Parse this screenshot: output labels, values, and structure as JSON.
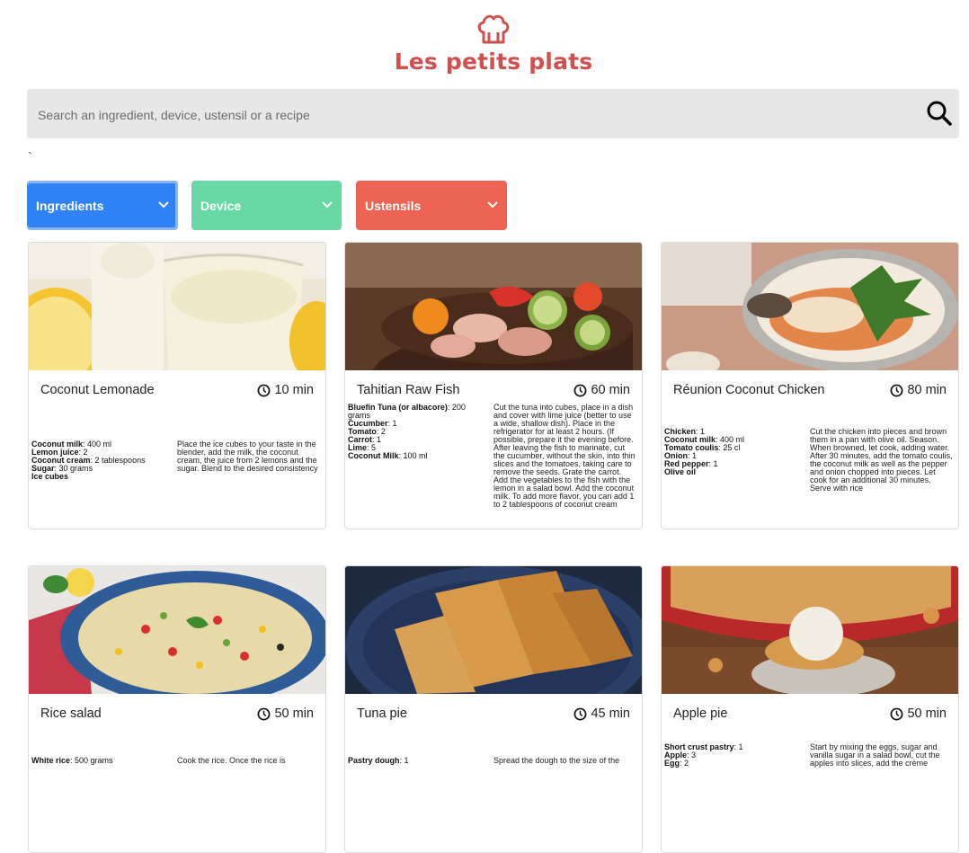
{
  "brand": {
    "title": "Les petits plats",
    "logo_icon": "chef-hat-icon",
    "color": "#D04F4F"
  },
  "search": {
    "placeholder": "Search an ingredient, device, ustensil or a recipe",
    "value": "",
    "icon": "search-icon"
  },
  "stray_text": "`",
  "filters": [
    {
      "label": "Ingredients",
      "color": "#3282F7",
      "icon": "chevron-down-icon"
    },
    {
      "label": "Device",
      "color": "#68D9A4",
      "icon": "chevron-down-icon"
    },
    {
      "label": "Ustensils",
      "color": "#ED6454",
      "icon": "chevron-down-icon"
    }
  ],
  "recipes": [
    {
      "title": "Coconut Lemonade",
      "time": "10 min",
      "clock_icon": "clock-icon",
      "ingredients": [
        {
          "name": "Coconut milk",
          "qty": "400 ml"
        },
        {
          "name": "Lemon juice",
          "qty": "2"
        },
        {
          "name": "Coconut cream",
          "qty": "2 tablespoons"
        },
        {
          "name": "Sugar",
          "qty": "30 grams"
        },
        {
          "name": "Ice cubes",
          "qty": ""
        }
      ],
      "description": "Place the ice cubes to your taste in the blender, add the milk, the coconut cream, the juice from 2 lemons and the sugar. Blend to the desired consistency"
    },
    {
      "title": "Tahitian Raw Fish",
      "time": "60 min",
      "clock_icon": "clock-icon",
      "ingredients": [
        {
          "name": "Bluefin Tuna (or albacore)",
          "qty": "200 grams"
        },
        {
          "name": "Cucumber",
          "qty": "1"
        },
        {
          "name": "Tomato",
          "qty": "2"
        },
        {
          "name": "Carrot",
          "qty": "1"
        },
        {
          "name": "Lime",
          "qty": "5"
        },
        {
          "name": "Coconut Milk",
          "qty": "100 ml"
        }
      ],
      "description": "Cut the tuna into cubes, place in a dish and cover with lime juice (better to use a wide, shallow dish). Place in the refrigerator for at least 2 hours. (If possible, prepare it the evening before. After leaving the fish to marinate, cut the cucumber, without the skin, into thin slices and the tomatoes, taking care to remove the seeds. Grate the carrot. Add the vegetables to the fish with the lemon in a salad bowl. Add the coconut milk. To add more flavor, you can add 1 to 2 tablespoons of coconut cream"
    },
    {
      "title": "Réunion Coconut Chicken",
      "time": "80 min",
      "clock_icon": "clock-icon",
      "ingredients": [
        {
          "name": "Chicken",
          "qty": "1"
        },
        {
          "name": "Coconut milk",
          "qty": "400 ml"
        },
        {
          "name": "Tomato coulis",
          "qty": "25 cl"
        },
        {
          "name": "Onion",
          "qty": "1"
        },
        {
          "name": "Red pepper",
          "qty": "1"
        },
        {
          "name": "Olive oil",
          "qty": ""
        }
      ],
      "description": "Cut the chicken into pieces and brown them in a pan with olive oil. Season. When browned, let cook, adding water. After 30 minutes, add the tomato coulis, the coconut milk as well as the pepper and onion chopped into pieces. Let cook for an additional 30 minutes. Serve with rice"
    },
    {
      "title": "Rice salad",
      "time": "50 min",
      "clock_icon": "clock-icon",
      "ingredients": [
        {
          "name": "White rice",
          "qty": "500 grams"
        }
      ],
      "description": "Cook the rice. Once the rice is"
    },
    {
      "title": "Tuna pie",
      "time": "45 min",
      "clock_icon": "clock-icon",
      "ingredients": [
        {
          "name": "Pastry dough",
          "qty": "1"
        }
      ],
      "description": "Spread the dough to the size of the"
    },
    {
      "title": "Apple pie",
      "time": "50 min",
      "clock_icon": "clock-icon",
      "ingredients": [
        {
          "name": "Short crust pastry",
          "qty": "1"
        },
        {
          "name": "Apple",
          "qty": "3"
        },
        {
          "name": "Egg",
          "qty": "2"
        }
      ],
      "description": "Start by mixing the eggs, sugar and vanilla sugar in a salad bowl, cut the apples into slices, add the crème"
    }
  ]
}
